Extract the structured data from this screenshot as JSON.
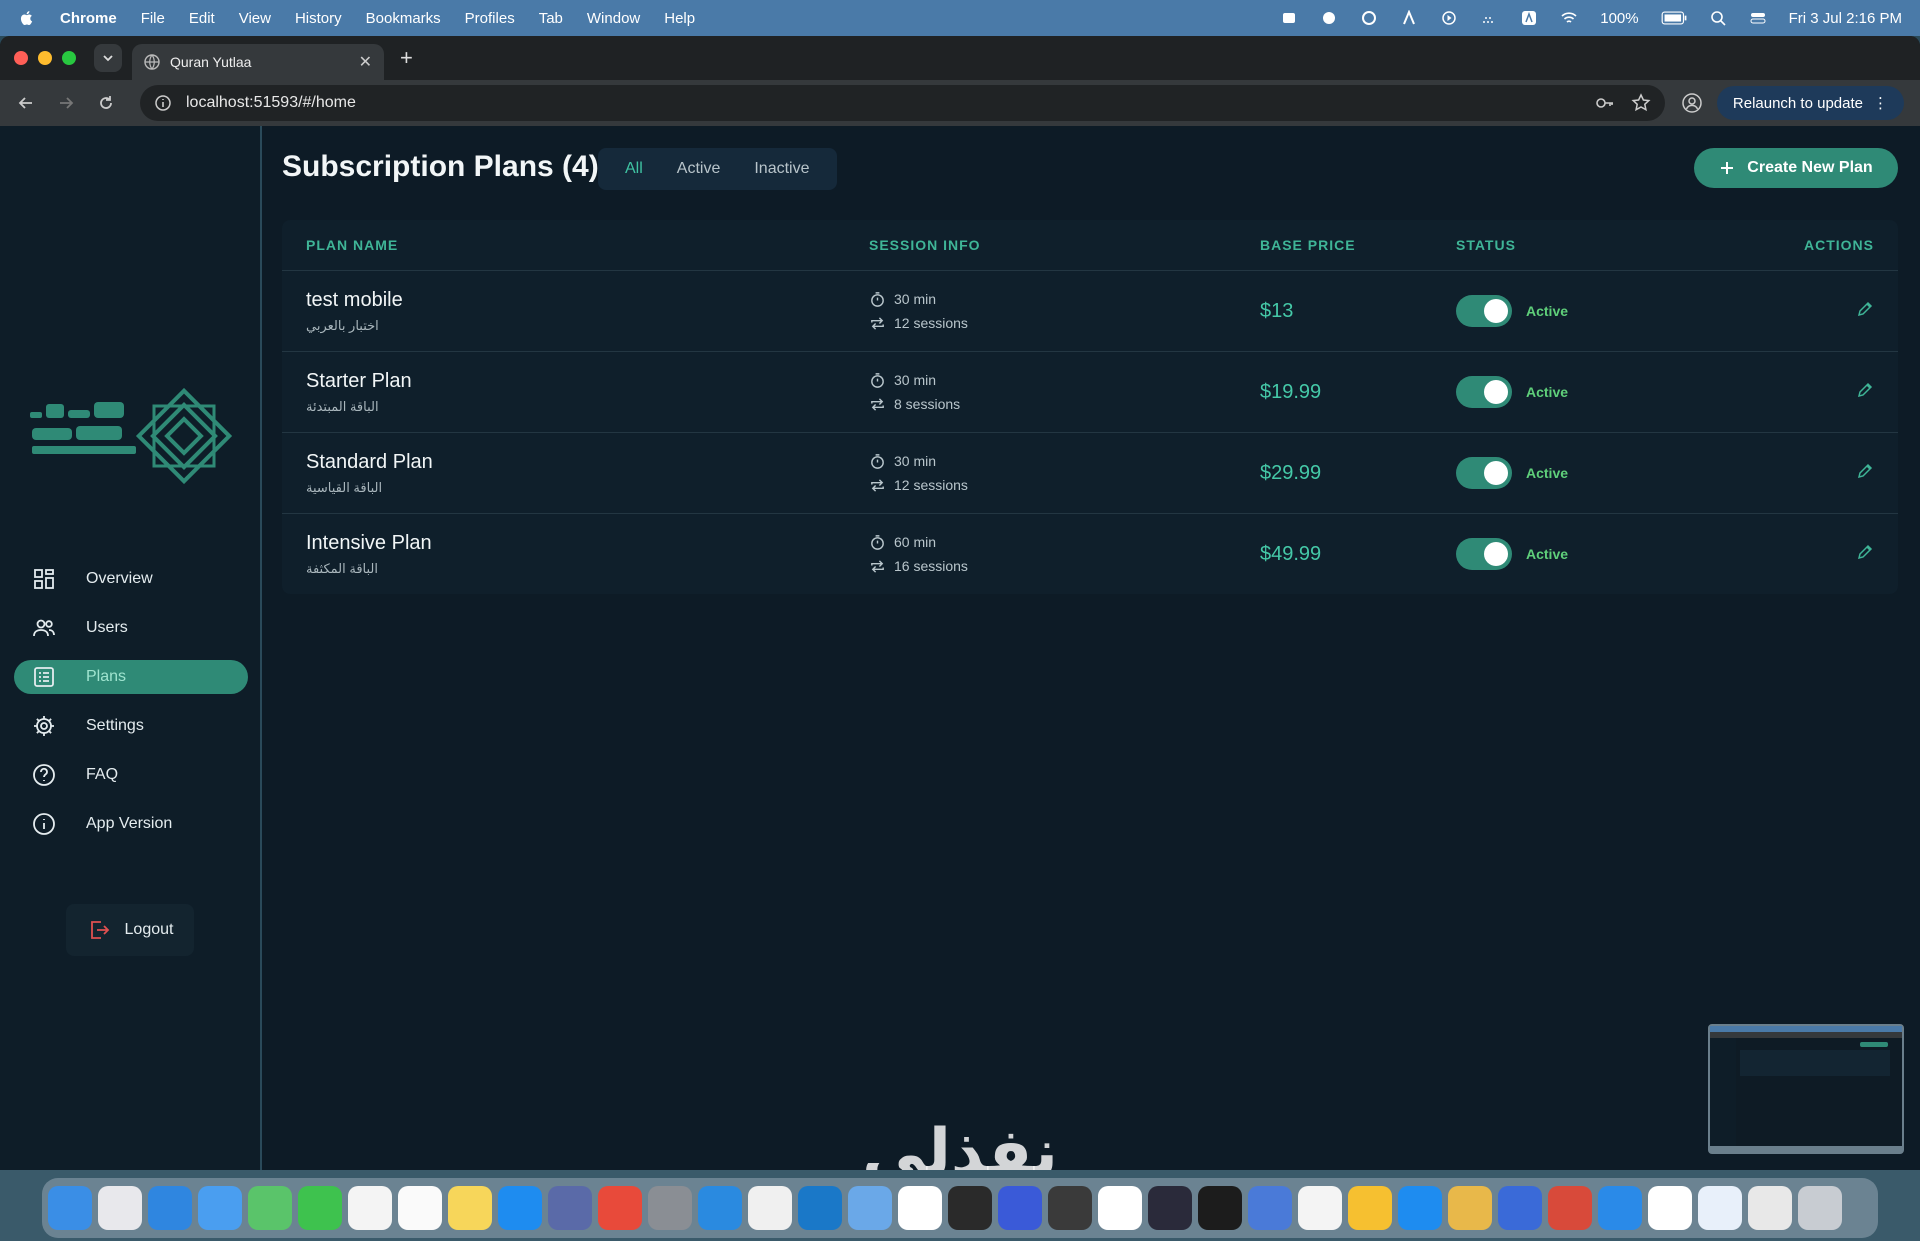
{
  "menubar": {
    "app": "Chrome",
    "items": [
      "File",
      "Edit",
      "View",
      "History",
      "Bookmarks",
      "Profiles",
      "Tab",
      "Window",
      "Help"
    ],
    "battery": "100%",
    "clock": "Fri 3 Jul  2:16 PM"
  },
  "browser": {
    "tab_title": "Quran Yutlaa",
    "url": "localhost:51593/#/home",
    "relaunch_label": "Relaunch to update"
  },
  "sidebar": {
    "items": [
      {
        "label": "Overview",
        "icon": "grid-icon"
      },
      {
        "label": "Users",
        "icon": "users-icon"
      },
      {
        "label": "Plans",
        "icon": "list-icon"
      },
      {
        "label": "Settings",
        "icon": "gear-icon"
      },
      {
        "label": "FAQ",
        "icon": "question-icon"
      },
      {
        "label": "App Version",
        "icon": "info-icon"
      }
    ],
    "logout_label": "Logout"
  },
  "page": {
    "title": "Subscription Plans (4)",
    "filters": [
      "All",
      "Active",
      "Inactive"
    ],
    "create_label": "Create New Plan"
  },
  "table": {
    "headers": {
      "name": "PLAN NAME",
      "session": "SESSION INFO",
      "price": "BASE PRICE",
      "status": "STATUS",
      "actions": "ACTIONS"
    },
    "rows": [
      {
        "name": "test mobile",
        "sub": "اختبار بالعربي",
        "duration": "30 min",
        "sessions": "12 sessions",
        "price": "$13",
        "status": "Active"
      },
      {
        "name": "Starter Plan",
        "sub": "الباقة المبتدئة",
        "duration": "30 min",
        "sessions": "8 sessions",
        "price": "$19.99",
        "status": "Active"
      },
      {
        "name": "Standard Plan",
        "sub": "الباقة القياسية",
        "duration": "30 min",
        "sessions": "12 sessions",
        "price": "$29.99",
        "status": "Active"
      },
      {
        "name": "Intensive Plan",
        "sub": "الباقة المكثفة",
        "duration": "60 min",
        "sessions": "16 sessions",
        "price": "$49.99",
        "status": "Active"
      }
    ]
  },
  "watermark": "نفذلي",
  "colors": {
    "accent": "#2f8a76",
    "accent_text": "#45c9a8",
    "active_status": "#5fcf7a",
    "background": "#0d1b26"
  }
}
